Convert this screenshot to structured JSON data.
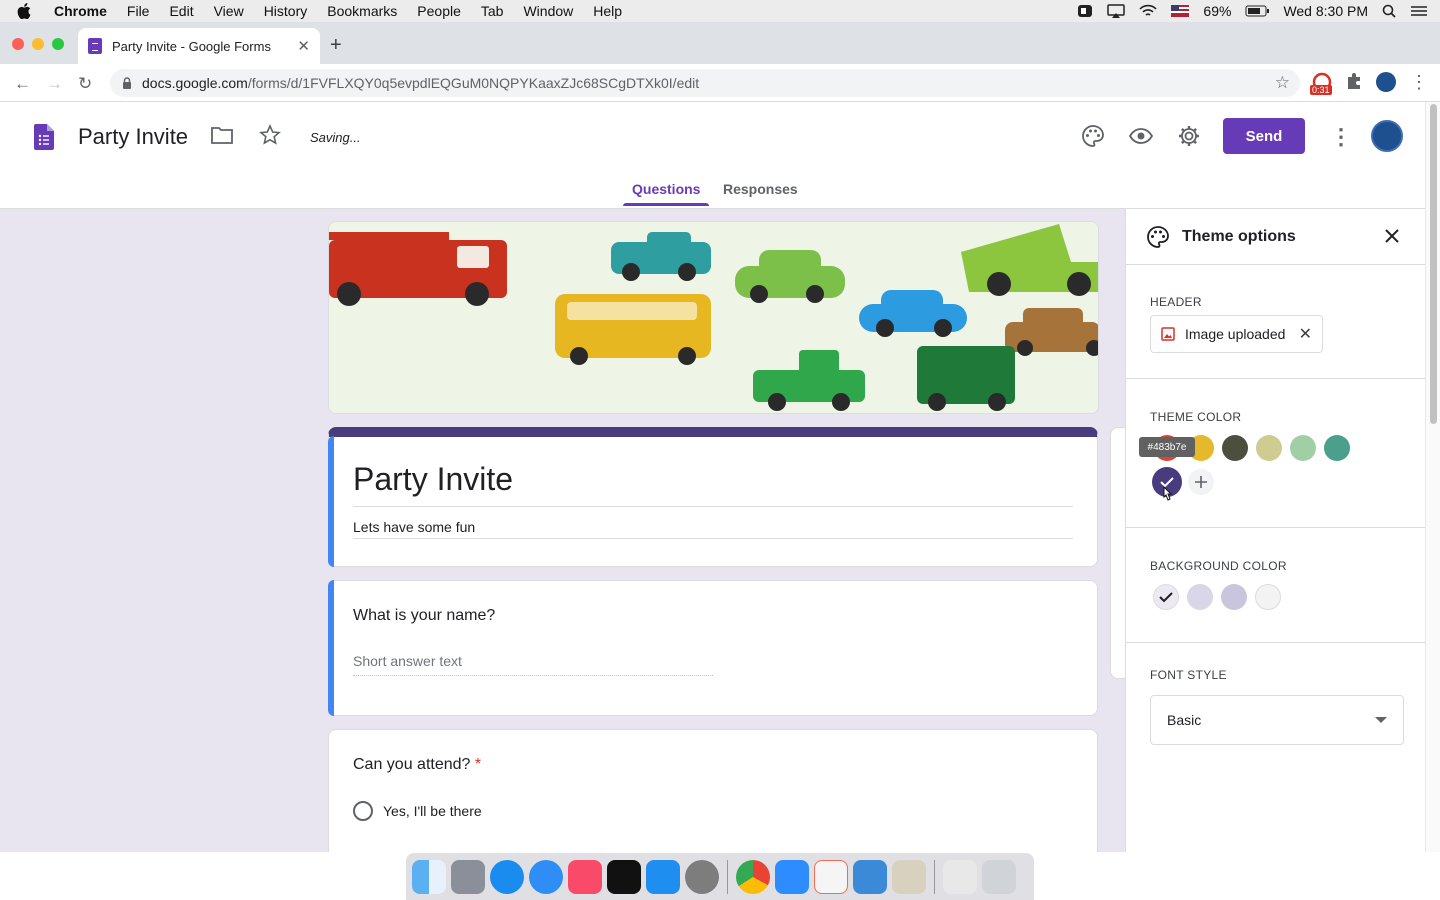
{
  "menubar": {
    "app": "Chrome",
    "items": [
      "File",
      "Edit",
      "View",
      "History",
      "Bookmarks",
      "People",
      "Tab",
      "Window",
      "Help"
    ],
    "battery": "69%",
    "clock": "Wed 8:30 PM"
  },
  "browser": {
    "tab_title": "Party Invite - Google Forms",
    "url_host": "docs.google.com",
    "url_path": "/forms/d/1FVFLXQY0q5evpdlEQGuM0NQPYKaaxZJc68SCgDTXk0I/edit",
    "ext_badge": "0:31"
  },
  "form_header": {
    "title": "Party Invite",
    "status": "Saving...",
    "send_label": "Send",
    "tabs": [
      {
        "label": "Questions",
        "active": true
      },
      {
        "label": "Responses",
        "active": false
      }
    ]
  },
  "form": {
    "title": "Party Invite",
    "description": "Lets have some fun",
    "questions": [
      {
        "title": "What is your name?",
        "hint": "Short answer text",
        "required": false
      },
      {
        "title": "Can you attend?",
        "required": true,
        "required_mark": "*",
        "options": [
          "Yes,  I'll be there"
        ]
      }
    ]
  },
  "theme_panel": {
    "title": "Theme options",
    "header_section": {
      "label": "HEADER",
      "chip_label": "Image uploaded"
    },
    "theme_color": {
      "label": "THEME COLOR",
      "tooltip": "#483b7e",
      "selected": "#483b7e",
      "swatches": [
        "#db4437",
        "#e6b82b",
        "#4c4f3d",
        "#cfcc91",
        "#a1cfa5",
        "#4aa08a",
        "#483b7e"
      ]
    },
    "background_color": {
      "label": "BACKGROUND COLOR",
      "swatches": [
        "#ece9f2",
        "#d9d6e7",
        "#c9c5dc",
        "#f3f3f3"
      ],
      "selected_index": 0
    },
    "font_style": {
      "label": "FONT STYLE",
      "value": "Basic"
    }
  },
  "colors": {
    "accent": "#673ab7",
    "theme": "#483b7e",
    "focus": "#4285f4"
  }
}
